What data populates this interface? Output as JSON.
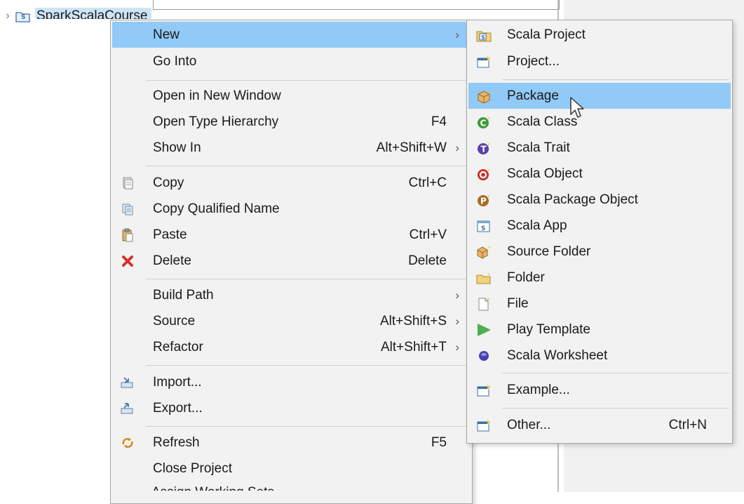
{
  "tree": {
    "project_label": "SparkScalaCourse"
  },
  "context_menu": {
    "items": {
      "new": {
        "label": "New"
      },
      "go_into": {
        "label": "Go Into"
      },
      "open_new_window": {
        "label": "Open in New Window"
      },
      "open_type_hierarchy": {
        "label": "Open Type Hierarchy",
        "shortcut": "F4"
      },
      "show_in": {
        "label": "Show In",
        "shortcut": "Alt+Shift+W"
      },
      "copy": {
        "label": "Copy",
        "shortcut": "Ctrl+C"
      },
      "copy_qualified": {
        "label": "Copy Qualified Name"
      },
      "paste": {
        "label": "Paste",
        "shortcut": "Ctrl+V"
      },
      "delete": {
        "label": "Delete",
        "shortcut": "Delete"
      },
      "build_path": {
        "label": "Build Path"
      },
      "source": {
        "label": "Source",
        "shortcut": "Alt+Shift+S"
      },
      "refactor": {
        "label": "Refactor",
        "shortcut": "Alt+Shift+T"
      },
      "import": {
        "label": "Import..."
      },
      "export": {
        "label": "Export..."
      },
      "refresh": {
        "label": "Refresh",
        "shortcut": "F5"
      },
      "close_project": {
        "label": "Close Project"
      },
      "assign_working_sets": {
        "label": "Assign Working Sets..."
      }
    }
  },
  "submenu_new": {
    "items": {
      "scala_project": {
        "label": "Scala Project"
      },
      "project": {
        "label": "Project..."
      },
      "package": {
        "label": "Package"
      },
      "scala_class": {
        "label": "Scala Class"
      },
      "scala_trait": {
        "label": "Scala Trait"
      },
      "scala_object": {
        "label": "Scala Object"
      },
      "scala_package_object": {
        "label": "Scala Package Object"
      },
      "scala_app": {
        "label": "Scala App"
      },
      "source_folder": {
        "label": "Source Folder"
      },
      "folder": {
        "label": "Folder"
      },
      "file": {
        "label": "File"
      },
      "play_template": {
        "label": "Play Template"
      },
      "scala_worksheet": {
        "label": "Scala Worksheet"
      },
      "example": {
        "label": "Example..."
      },
      "other": {
        "label": "Other...",
        "shortcut": "Ctrl+N"
      }
    }
  },
  "colors": {
    "highlight": "#91c9f7",
    "menu_bg": "#f2f2f2"
  }
}
